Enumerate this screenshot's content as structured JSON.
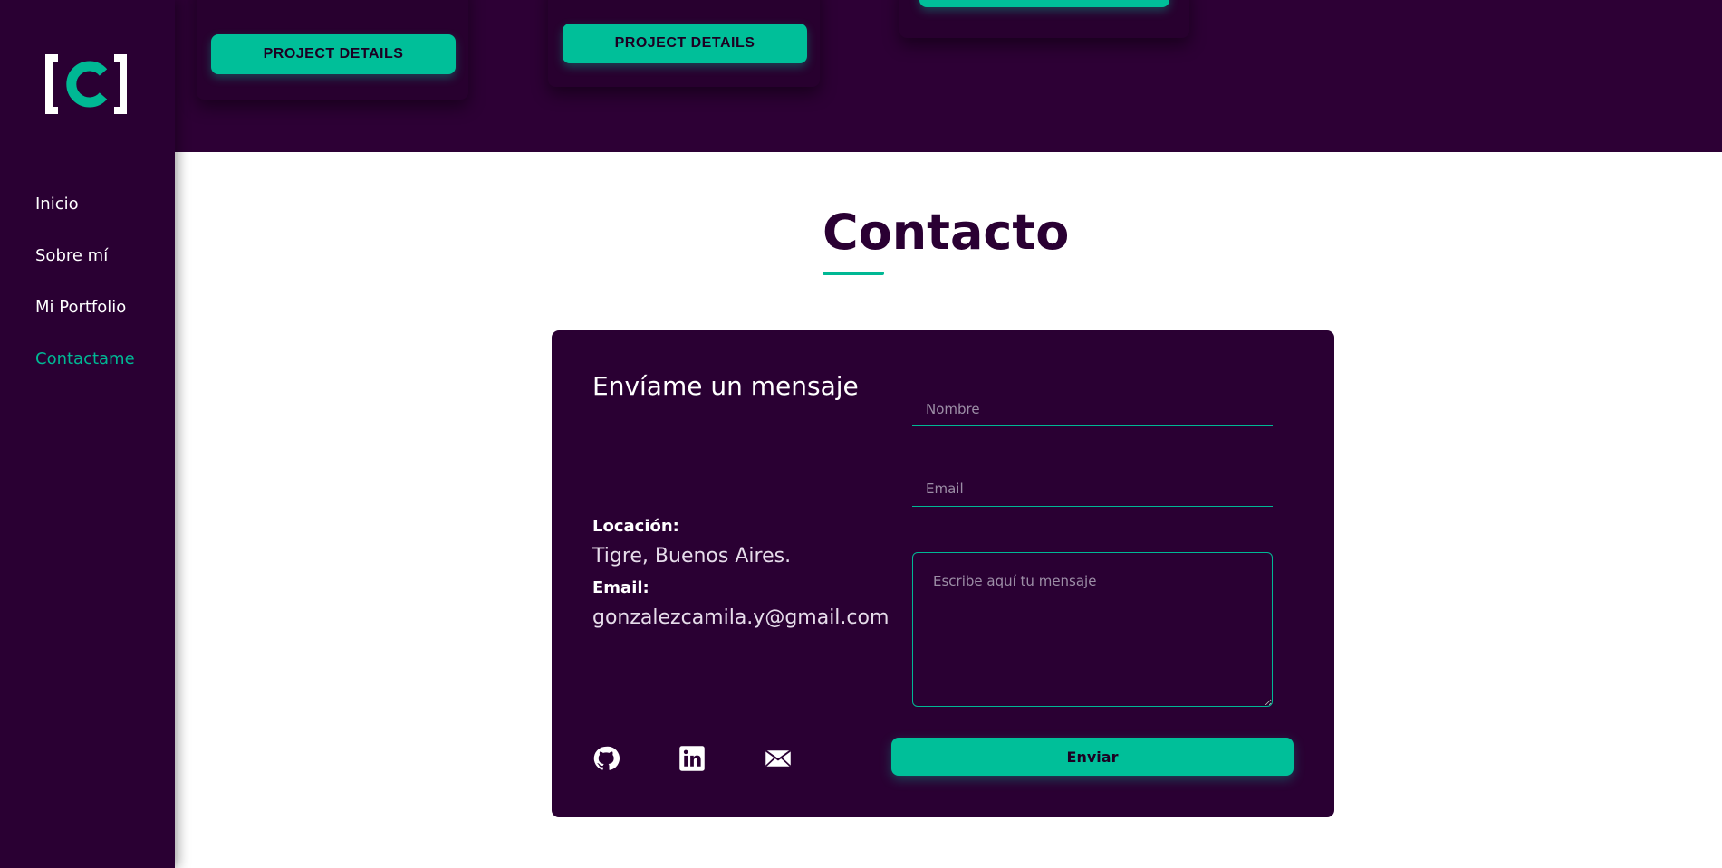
{
  "brand": {
    "logo_letter": "C",
    "accent": "#00b894",
    "primary_dark": "#2a0033"
  },
  "sidebar": {
    "items": [
      {
        "label": "Inicio"
      },
      {
        "label": "Sobre mí"
      },
      {
        "label": "Mi Portfolio"
      },
      {
        "label": "Contactame",
        "active": true
      }
    ]
  },
  "projects": {
    "cards": [
      {
        "button_label": "PROJECT DETAILS",
        "icons": [
          "github-icon",
          "globe-icon",
          "code-icon"
        ]
      },
      {
        "button_label": "PROJECT DETAILS"
      },
      {
        "button_label": ""
      }
    ]
  },
  "contact": {
    "title": "Contacto",
    "heading": "Envíame un mensaje",
    "location_label": "Locación:",
    "location_value": "Tigre, Buenos Aires.",
    "email_label": "Email:",
    "email_value": "gonzalezcamila.y@gmail.com",
    "form": {
      "name_placeholder": "Nombre",
      "email_placeholder": "Email",
      "message_placeholder": "Escribe aquí tu mensaje",
      "submit_label": "Enviar"
    },
    "social_icons": [
      "github-icon",
      "linkedin-icon",
      "mail-icon"
    ]
  }
}
